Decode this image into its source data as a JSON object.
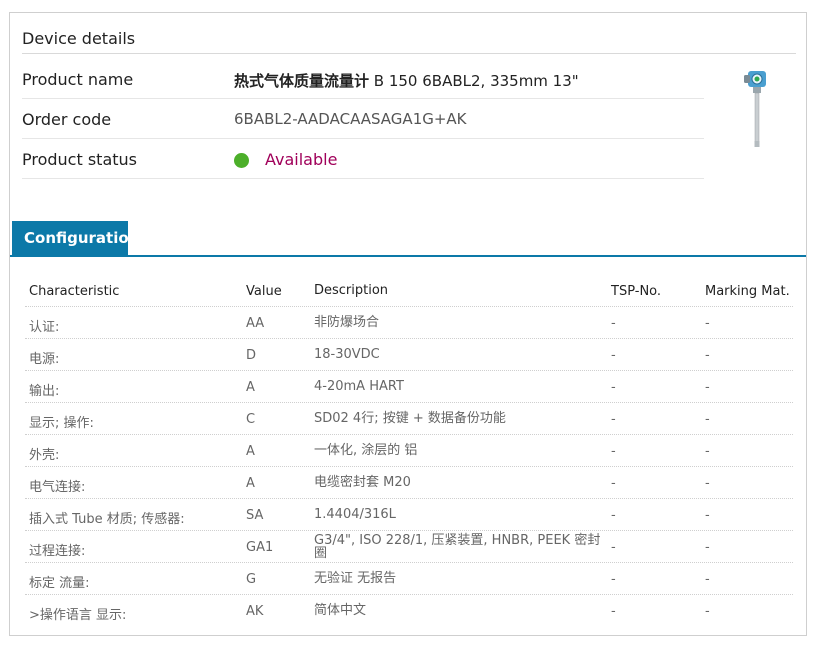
{
  "device": {
    "title": "Device details",
    "product_name_label": "Product name",
    "product_name_bold": "热式气体质量流量计",
    "product_name_rest": " B 150 6BABL2, 335mm 13\"",
    "order_code_label": "Order code",
    "order_code": "6BABL2-AADACAASAGA1G+AK",
    "status_label": "Product status",
    "status_value": "Available",
    "status_color": "#4caf2a",
    "product_image_icon": "flowmeter-device-image"
  },
  "configuration": {
    "tab_label": "Configuration",
    "accent_color": "#0c79a8",
    "columns": [
      "Characteristic",
      "Value",
      "Description",
      "TSP-No.",
      "Marking Mat."
    ],
    "rows": [
      {
        "characteristic": "认证:",
        "value": "AA",
        "description": "非防爆场合",
        "tsp": "-",
        "marking": "-"
      },
      {
        "characteristic": "电源:",
        "value": "D",
        "description": "18-30VDC",
        "tsp": "-",
        "marking": "-"
      },
      {
        "characteristic": "输出:",
        "value": "A",
        "description": "4-20mA HART",
        "tsp": "-",
        "marking": "-"
      },
      {
        "characteristic": "显示; 操作:",
        "value": "C",
        "description": "SD02 4行; 按键 + 数据备份功能",
        "tsp": "-",
        "marking": "-"
      },
      {
        "characteristic": "外壳:",
        "value": "A",
        "description": "一体化, 涂层的 铝",
        "tsp": "-",
        "marking": "-"
      },
      {
        "characteristic": "电气连接:",
        "value": "A",
        "description": "电缆密封套 M20",
        "tsp": "-",
        "marking": "-"
      },
      {
        "characteristic": "插入式 Tube 材质; 传感器:",
        "value": "SA",
        "description": "1.4404/316L",
        "tsp": "-",
        "marking": "-"
      },
      {
        "characteristic": "过程连接:",
        "value": "GA1",
        "description": "G3/4\", ISO 228/1, 压紧装置, HNBR, PEEK 密封圈",
        "tsp": "-",
        "marking": "-"
      },
      {
        "characteristic": "标定 流量:",
        "value": "G",
        "description": "无验证 无报告",
        "tsp": "-",
        "marking": "-"
      },
      {
        "characteristic": ">操作语言 显示:",
        "value": "AK",
        "description": "简体中文",
        "tsp": "-",
        "marking": "-"
      }
    ]
  }
}
